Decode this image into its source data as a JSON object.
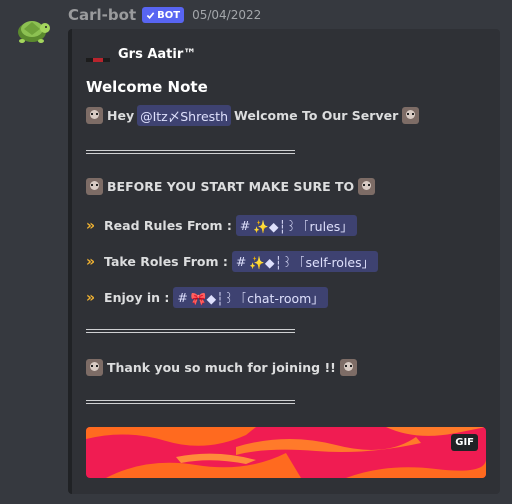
{
  "author": {
    "name": "Carl-bot",
    "bot_tag": "BOT",
    "timestamp": "05/04/2022"
  },
  "embed": {
    "author_name": "Grs Aatir™",
    "title": "Welcome Note",
    "hey_text": "Hey",
    "mention": "@Itz〆Shresth",
    "welcome_text": "Welcome To Our Server",
    "before_text": "BEFORE YOU START MAKE SURE TO",
    "rules_label": "Read Rules From :",
    "rules_channel": "✨◆┆꒱ 「rules」",
    "roles_label": "Take Roles From :",
    "roles_channel": "✨◆┆꒱ 「self-roles」",
    "enjoy_label": "Enjoy in :",
    "chat_channel": "🎀◆┆꒱ 「chat-room」",
    "thanks_text": "Thank you so much for joining !!",
    "arrow_glyph": "»",
    "channel_hash": "#",
    "gif_badge": "GIF"
  },
  "colors": {
    "background": "#36393f",
    "embed_bg": "#2f3136",
    "bot_tag": "#5865f2",
    "mention_bg": "#3e4271",
    "arrow": "#f0b232",
    "gif_red": "#f01c52",
    "gif_orange": "#ff6a1f"
  },
  "icons": {
    "avatar": "turtle-avatar",
    "verified": "checkmark-icon",
    "emoji": "custom-emoji-face"
  }
}
